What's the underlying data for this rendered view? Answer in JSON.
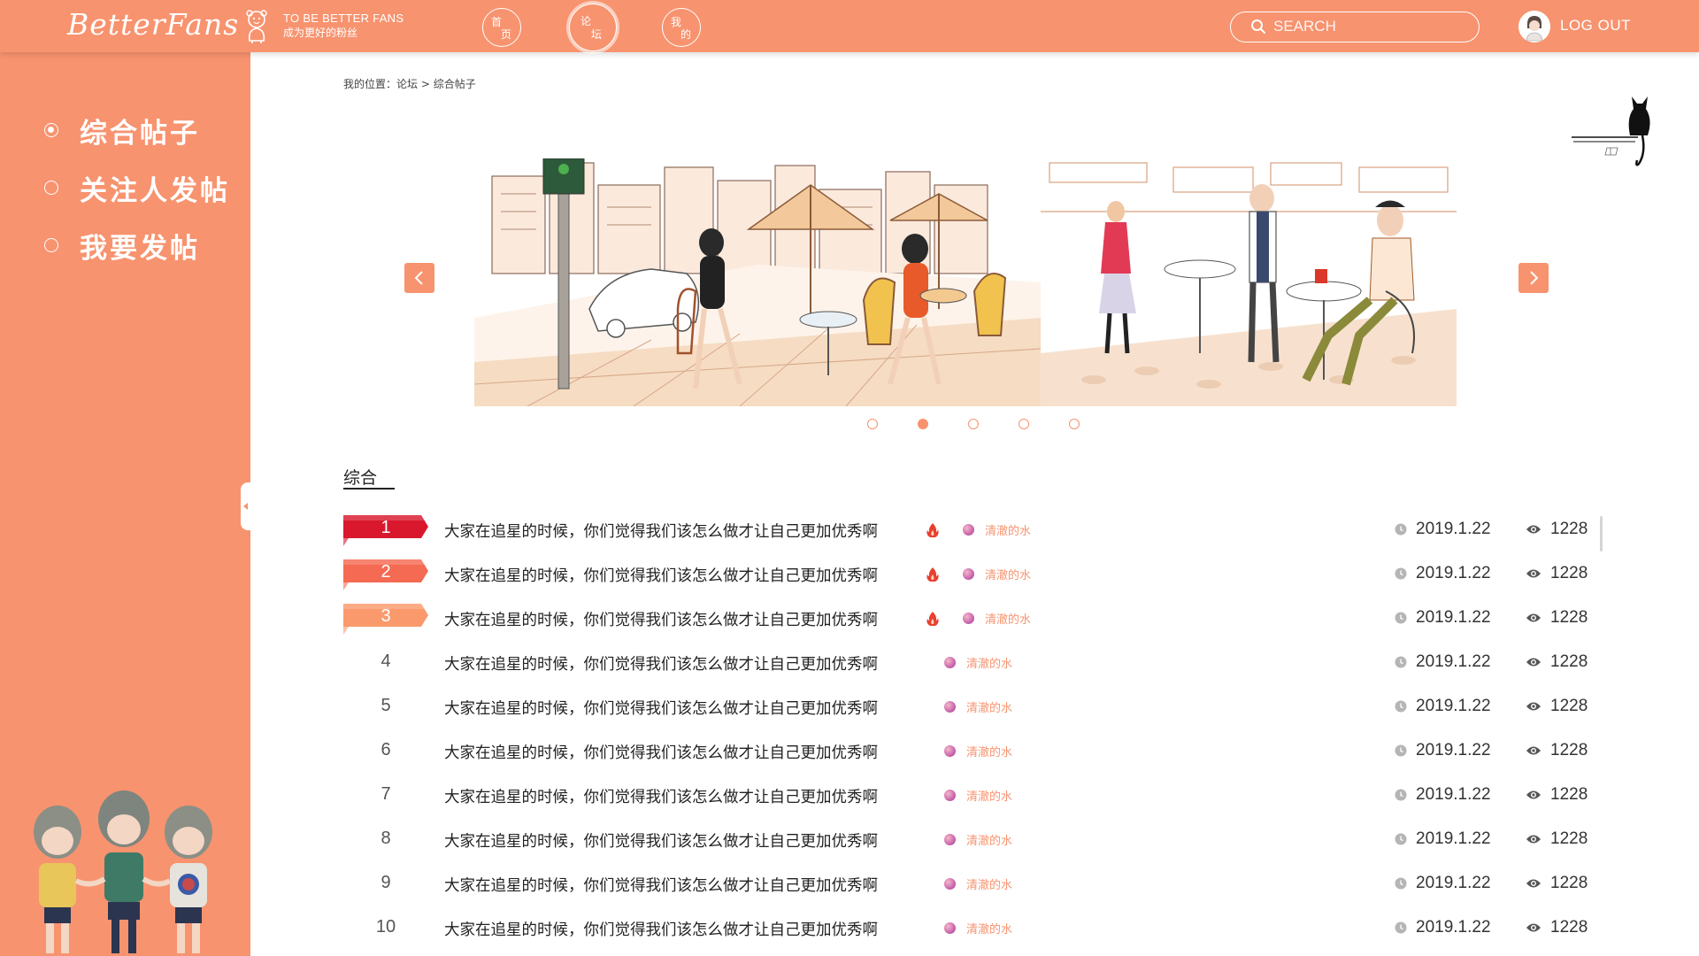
{
  "header": {
    "logo": "BetterFans",
    "slogan_en": "TO BE BETTER FANS",
    "slogan_cn": "成为更好的粉丝",
    "nav": [
      {
        "c1": "首",
        "c2": "页"
      },
      {
        "c1": "论",
        "c2": "坛"
      },
      {
        "c1": "我",
        "c2": "的"
      }
    ],
    "active_nav": "论坛",
    "search_placeholder": "SEARCH",
    "logout": "LOG OUT"
  },
  "sidebar": {
    "items": [
      {
        "label": "综合帖子"
      },
      {
        "label": "关注人发帖"
      },
      {
        "label": "我要发帖"
      }
    ],
    "selected": "综合帖子"
  },
  "breadcrumb": {
    "prefix": "我的位置：",
    "parent": "论坛",
    "sep": " > ",
    "current": "综合帖子"
  },
  "carousel": {
    "slide_count": 5,
    "active_index": 1
  },
  "section": {
    "title": "综合"
  },
  "colors": {
    "accent": "#f7936f",
    "rank1": "#d9182e",
    "rank2": "#f56a52",
    "rank3": "#fa9a6c",
    "tag_text": "#f7936f"
  },
  "posts": [
    {
      "rank": "1",
      "title": "大家在追星的时候，你们觉得我们该怎么做才让自己更加优秀啊",
      "hot": true,
      "tag": "清澈的水",
      "date": "2019.1.22",
      "views": "1228"
    },
    {
      "rank": "2",
      "title": "大家在追星的时候，你们觉得我们该怎么做才让自己更加优秀啊",
      "hot": true,
      "tag": "清澈的水",
      "date": "2019.1.22",
      "views": "1228"
    },
    {
      "rank": "3",
      "title": "大家在追星的时候，你们觉得我们该怎么做才让自己更加优秀啊",
      "hot": true,
      "tag": "清澈的水",
      "date": "2019.1.22",
      "views": "1228"
    },
    {
      "rank": "4",
      "title": "大家在追星的时候，你们觉得我们该怎么做才让自己更加优秀啊",
      "hot": false,
      "tag": "清澈的水",
      "date": "2019.1.22",
      "views": "1228"
    },
    {
      "rank": "5",
      "title": "大家在追星的时候，你们觉得我们该怎么做才让自己更加优秀啊",
      "hot": false,
      "tag": "清澈的水",
      "date": "2019.1.22",
      "views": "1228"
    },
    {
      "rank": "6",
      "title": "大家在追星的时候，你们觉得我们该怎么做才让自己更加优秀啊",
      "hot": false,
      "tag": "清澈的水",
      "date": "2019.1.22",
      "views": "1228"
    },
    {
      "rank": "7",
      "title": "大家在追星的时候，你们觉得我们该怎么做才让自己更加优秀啊",
      "hot": false,
      "tag": "清澈的水",
      "date": "2019.1.22",
      "views": "1228"
    },
    {
      "rank": "8",
      "title": "大家在追星的时候，你们觉得我们该怎么做才让自己更加优秀啊",
      "hot": false,
      "tag": "清澈的水",
      "date": "2019.1.22",
      "views": "1228"
    },
    {
      "rank": "9",
      "title": "大家在追星的时候，你们觉得我们该怎么做才让自己更加优秀啊",
      "hot": false,
      "tag": "清澈的水",
      "date": "2019.1.22",
      "views": "1228"
    },
    {
      "rank": "10",
      "title": "大家在追星的时候，你们觉得我们该怎么做才让自己更加优秀啊",
      "hot": false,
      "tag": "清澈的水",
      "date": "2019.1.22",
      "views": "1228"
    }
  ]
}
